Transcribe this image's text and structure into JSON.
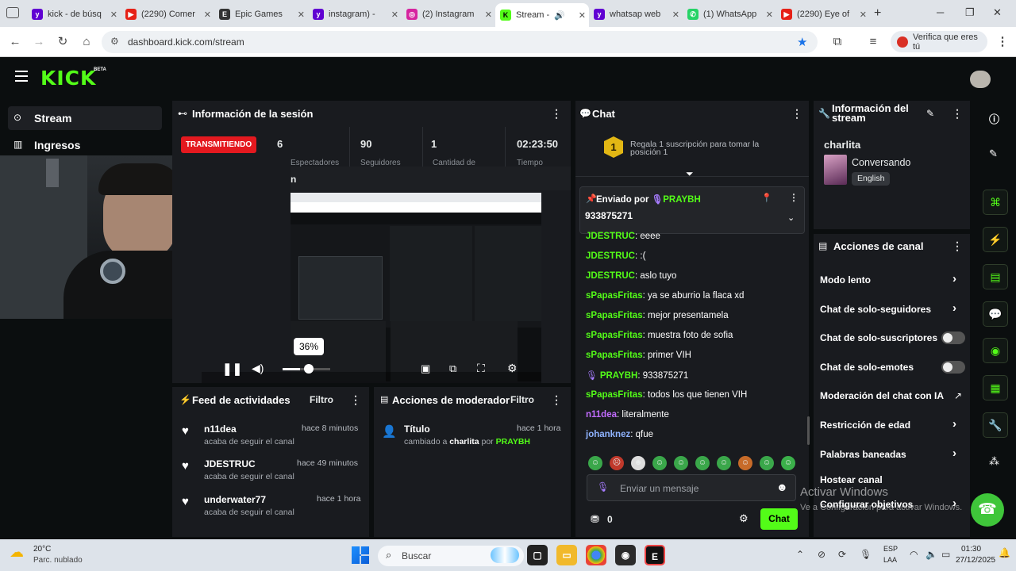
{
  "browser": {
    "tabs": [
      {
        "label": "kick - de búsq",
        "icon": "yahoo-icon",
        "color": "#6001d2"
      },
      {
        "label": "(2290) Comer",
        "icon": "youtube-icon",
        "color": "#e62117"
      },
      {
        "label": "Epic Games",
        "icon": "epic-icon",
        "color": "#333333"
      },
      {
        "label": "instagram) -",
        "icon": "yahoo-icon",
        "color": "#6001d2"
      },
      {
        "label": "(2) Instagram",
        "icon": "instagram-icon",
        "color": "#d6249f"
      },
      {
        "label": "Stream -",
        "icon": "kick-icon",
        "color": "#53fc18"
      },
      {
        "label": "whatsap web",
        "icon": "yahoo-icon",
        "color": "#6001d2"
      },
      {
        "label": "(1) WhatsApp",
        "icon": "whatsapp-icon",
        "color": "#25d366"
      },
      {
        "label": "(2290) Eye of",
        "icon": "youtube-icon",
        "color": "#e62117"
      }
    ],
    "url": "dashboard.kick.com/stream",
    "verify_label": "Verifica que eres tú"
  },
  "kick": {
    "logo": "KICK",
    "beta": "BETA",
    "nav": [
      {
        "label": "Stream",
        "icon": "broadcast-icon"
      },
      {
        "label": "Ingresos",
        "icon": "chart-icon"
      }
    ],
    "session": {
      "title": "Información de la sesión",
      "status": "TRANSMITIENDO",
      "stats": [
        {
          "value": "6",
          "label": "Espectadores"
        },
        {
          "value": "90",
          "label": "Seguidores"
        },
        {
          "value": "1",
          "label": "Cantidad de"
        },
        {
          "value": "02:23:50",
          "label": "Tiempo"
        }
      ],
      "preview_title": "n",
      "volume": "36%"
    },
    "feed": {
      "title": "Feed de actividades",
      "filter": "Filtro",
      "items": [
        {
          "user": "n11dea",
          "action": "acaba de seguir el canal",
          "time": "hace 8 minutos"
        },
        {
          "user": "JDESTRUC",
          "action": "acaba de seguir el canal",
          "time": "hace 49 minutos"
        },
        {
          "user": "underwater77",
          "action": "acaba de seguir el canal",
          "time": "hace 1 hora"
        }
      ]
    },
    "mod": {
      "title": "Acciones de moderador",
      "filter": "Filtro",
      "item_title": "Título",
      "item_changed": "cambiado a",
      "item_value": "charlita",
      "item_by": "por",
      "item_user": "PRAYBH",
      "item_time": "hace 1 hora"
    },
    "chat": {
      "title": "Chat",
      "gift_rank": "1",
      "gift_text_1": "Regala 1 suscripción para tomar la",
      "gift_text_2": "posición 1",
      "pinned_label": "Enviado por",
      "pinned_user": "PRAYBH",
      "pinned_message": "933875271",
      "messages": [
        {
          "user": "JDESTRUC",
          "text": "eeee"
        },
        {
          "user": "JDESTRUC",
          "text": ":("
        },
        {
          "user": "JDESTRUC",
          "text": "aslo tuyo"
        },
        {
          "user": "sPapasFritas",
          "text": "ya se aburrio la flaca xd"
        },
        {
          "user": "sPapasFritas",
          "text": "mejor presentamela"
        },
        {
          "user": "sPapasFritas",
          "text": "muestra foto de sofia"
        },
        {
          "user": "sPapasFritas",
          "text": "primer VIH"
        },
        {
          "user": "PRAYBH",
          "text": "933875271"
        },
        {
          "user": "sPapasFritas",
          "text": "todos los que tienen VIH"
        },
        {
          "user": "n11dea",
          "text": "literalmente"
        },
        {
          "user": "johanknez",
          "text": "qfue"
        }
      ],
      "placeholder": "Enviar un mensaje",
      "points": "0",
      "send": "Chat"
    },
    "stream_info": {
      "title": "Información del stream",
      "channel": "charlita",
      "category": "Conversando",
      "language": "English"
    },
    "channel_actions": {
      "title": "Acciones de canal",
      "items": [
        {
          "label": "Modo lento",
          "control": "chevron"
        },
        {
          "label": "Chat de solo-seguidores",
          "control": "chevron"
        },
        {
          "label": "Chat de solo-suscriptores",
          "control": "toggle"
        },
        {
          "label": "Chat de solo-emotes",
          "control": "toggle"
        },
        {
          "label": "Moderación del chat con IA",
          "control": "external"
        },
        {
          "label": "Restricción de edad",
          "control": "chevron"
        },
        {
          "label": "Palabras baneadas",
          "control": "chevron"
        },
        {
          "label": "Hostear canal",
          "control": "none"
        },
        {
          "label": "Configurar objetivos",
          "control": "chevron"
        }
      ]
    },
    "watermark": {
      "line1": "Activar Windows",
      "line2": "Ve a Configuración para activar Windows."
    }
  },
  "taskbar": {
    "weather_temp": "20°C",
    "weather_desc": "Parc. nublado",
    "search": "Buscar",
    "lang": "ESP",
    "lang2": "LAA",
    "time": "01:30",
    "date": "27/12/2025"
  }
}
